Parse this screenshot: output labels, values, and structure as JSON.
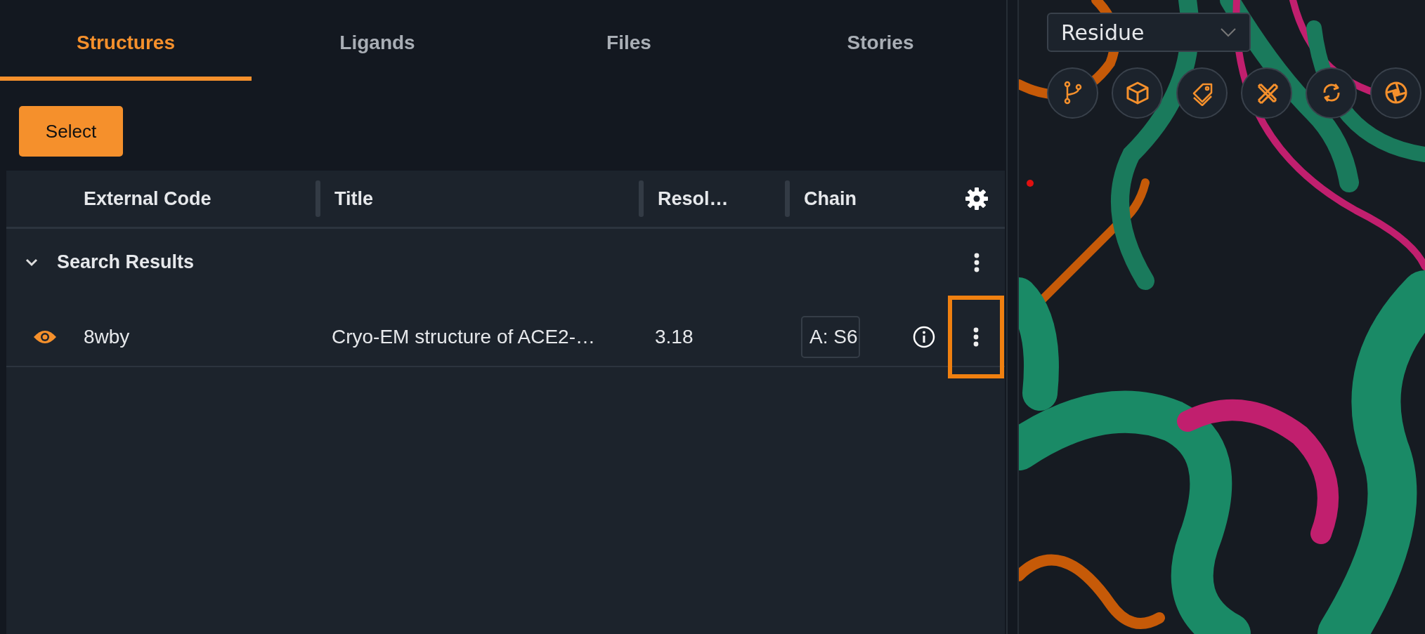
{
  "tabs": [
    {
      "label": "Structures",
      "selected": true
    },
    {
      "label": "Ligands",
      "selected": false
    },
    {
      "label": "Files",
      "selected": false
    },
    {
      "label": "Stories",
      "selected": false
    }
  ],
  "select_button": "Select",
  "table": {
    "columns": [
      "External Code",
      "Title",
      "Resol…",
      "Chain"
    ],
    "groups": [
      {
        "title": "Search Results",
        "expanded": true,
        "rows": [
          {
            "visible": true,
            "external_code": "8wby",
            "title": "Cryo-EM structure of ACE2-…",
            "resolution": "3.18",
            "chain": "A: S6",
            "menu_highlighted": true
          }
        ]
      }
    ]
  },
  "viewer": {
    "mode_select": "Residue"
  }
}
